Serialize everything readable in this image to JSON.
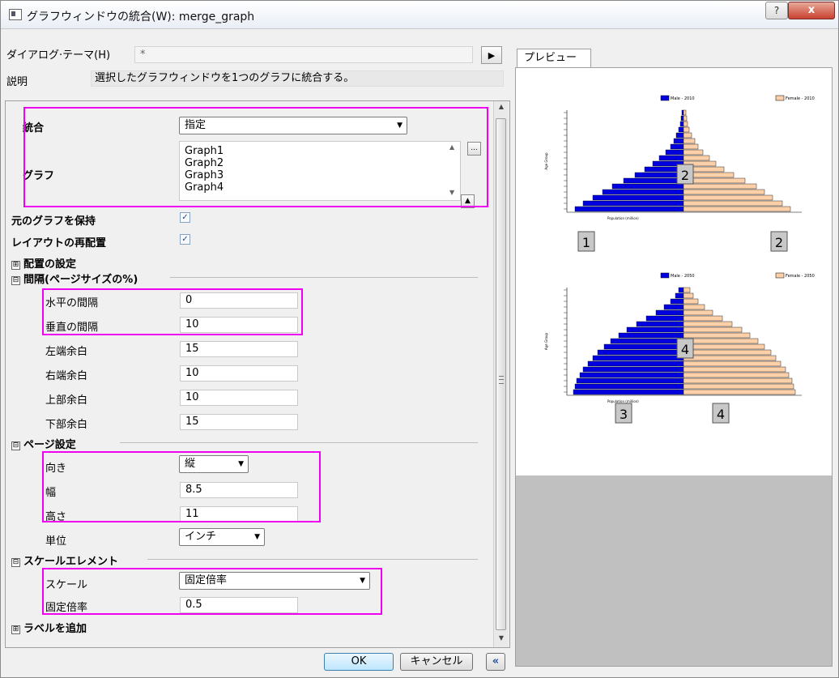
{
  "window": {
    "title": "グラフウィンドウの統合(W): merge_graph",
    "help": "?",
    "close": "x"
  },
  "theme": {
    "label": "ダイアログ·テーマ(H)",
    "value": "*"
  },
  "description": {
    "label": "説明",
    "text": "選択したグラフウィンドウを1つのグラフに統合する。"
  },
  "merge": {
    "label": "統合",
    "value": "指定"
  },
  "graphs": {
    "label": "グラフ",
    "items": [
      "Graph1",
      "Graph2",
      "Graph3",
      "Graph4"
    ],
    "browse": "..."
  },
  "keep_source": {
    "label": "元のグラフを保持",
    "checked": true
  },
  "rearrange": {
    "label": "レイアウトの再配置",
    "checked": true
  },
  "arrange_section": {
    "label": "配置の設定",
    "toggle": "⊞"
  },
  "spacing_section": {
    "label": "間隔(ページサイズの%)",
    "toggle": "⊟",
    "horizontal_gap": {
      "label": "水平の間隔",
      "value": "0"
    },
    "vertical_gap": {
      "label": "垂直の間隔",
      "value": "10"
    },
    "left_margin": {
      "label": "左端余白",
      "value": "15"
    },
    "right_margin": {
      "label": "右端余白",
      "value": "10"
    },
    "top_margin": {
      "label": "上部余白",
      "value": "10"
    },
    "bottom_margin": {
      "label": "下部余白",
      "value": "15"
    }
  },
  "page_section": {
    "label": "ページ設定",
    "toggle": "⊟",
    "orientation": {
      "label": "向き",
      "value": "縦"
    },
    "width": {
      "label": "幅",
      "value": "8.5"
    },
    "height": {
      "label": "高さ",
      "value": "11"
    },
    "units": {
      "label": "単位",
      "value": "インチ"
    }
  },
  "scale_section": {
    "label": "スケールエレメント",
    "toggle": "⊟",
    "scale": {
      "label": "スケール",
      "value": "固定倍率"
    },
    "fixed_factor": {
      "label": "固定倍率",
      "value": "0.5"
    }
  },
  "add_label": {
    "label": "ラベルを追加",
    "toggle": "⊞"
  },
  "buttons": {
    "ok": "OK",
    "cancel": "キャンセル",
    "collapse": "«"
  },
  "preview": {
    "tab": "プレビュー",
    "graph_numbers": [
      "1",
      "2",
      "2",
      "4",
      "3",
      "4"
    ],
    "legends": [
      "Male - 2010",
      "Female - 2010",
      "Male - 2050",
      "Female - 2050"
    ],
    "axis_title_x": "Population (million)",
    "axis_title_y": "Age Group"
  },
  "colors": {
    "highlight": "#f000f0",
    "male": "#0000e0",
    "female": "#fcd0a8"
  }
}
